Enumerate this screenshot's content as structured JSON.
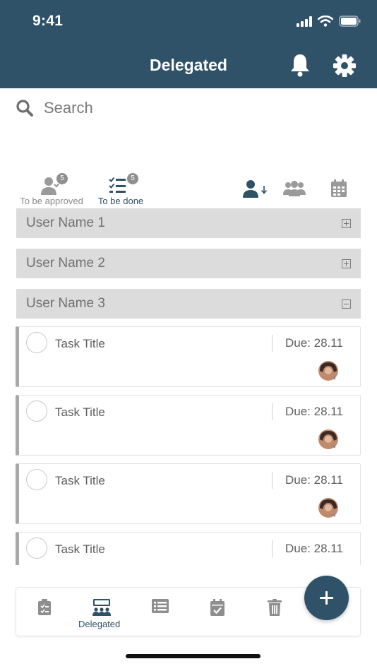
{
  "status_bar": {
    "time": "9:41"
  },
  "header": {
    "title": "Delegated"
  },
  "search": {
    "placeholder": "Search"
  },
  "filter_tabs": [
    {
      "label": "To be approved",
      "badge": "5"
    },
    {
      "label": "To be done",
      "badge": "5"
    }
  ],
  "groups": [
    {
      "name": "User Name 1",
      "state": "collapsed"
    },
    {
      "name": "User Name 2",
      "state": "collapsed"
    },
    {
      "name": "User Name 3",
      "state": "expanded"
    }
  ],
  "tasks": [
    {
      "title": "Task Title",
      "due": "Due: 28.11"
    },
    {
      "title": "Task Title",
      "due": "Due: 28.11"
    },
    {
      "title": "Task Title",
      "due": "Due: 28.11"
    },
    {
      "title": "Task Title",
      "due": "Due: 28.11"
    }
  ],
  "bottom_nav": {
    "active_label": "Delegated"
  },
  "colors": {
    "primary": "#2f5269",
    "group_bg": "#dcdcdc",
    "accent_bar": "#a8a8a8"
  }
}
